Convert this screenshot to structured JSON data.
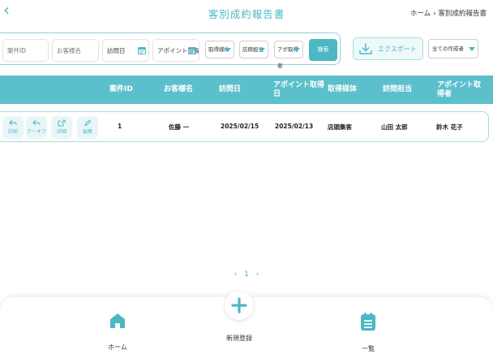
{
  "header": {
    "title": "客別成約報告書",
    "breadcrumb": [
      "ホーム",
      "客別成約報告書"
    ]
  },
  "filters": {
    "case_id_placeholder": "案件ID",
    "customer_placeholder": "お客様名",
    "visit_date_placeholder": "訪問日",
    "appoint_date_placeholder": "アポイント取得日",
    "select1": "取得媒体",
    "select2": "訪問担当",
    "select3": "アポ取得者",
    "search_label": "検索"
  },
  "actions": {
    "export_label": "エクスポート",
    "creator_select": "全ての作成者"
  },
  "table": {
    "columns": [
      "案件ID",
      "お客様名",
      "訪問日",
      "アポイント取得日",
      "取得媒体",
      "訪問担当",
      "アポイント取得者"
    ],
    "row_actions": [
      "印刷",
      "クーオフ",
      "詳細",
      "編集"
    ],
    "rows": [
      [
        "1",
        "佐藤 一",
        "2025/02/15",
        "2025/02/13",
        "店頭集客",
        "山田 太郎",
        "鈴木 花子"
      ]
    ]
  },
  "pagination": {
    "prev": "‹",
    "current": "1",
    "next": "›"
  },
  "bottom_nav": {
    "home": "ホーム",
    "new": "新規登録",
    "list": "一覧"
  },
  "colors": {
    "accent": "#4bb8c4",
    "header_bg": "#5bc0cc"
  }
}
